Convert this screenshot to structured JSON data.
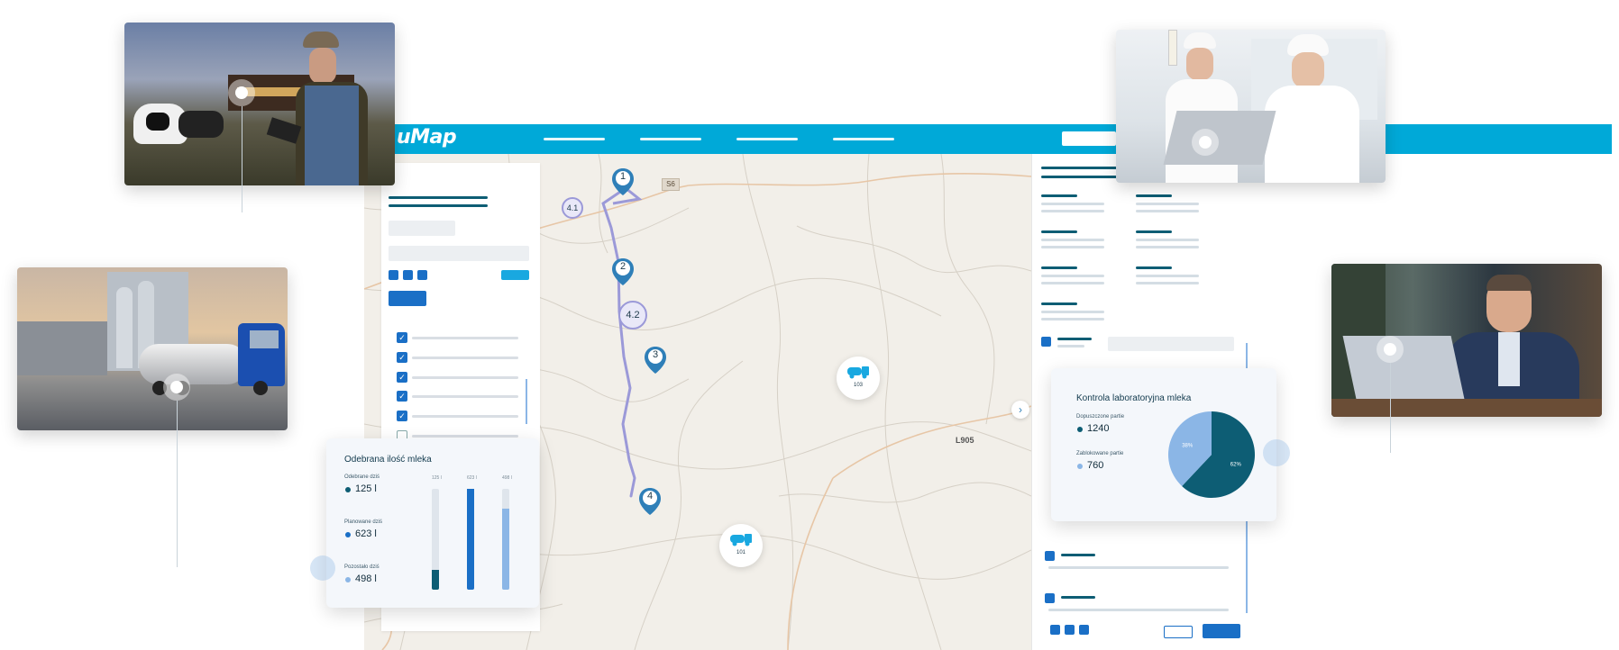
{
  "app": {
    "logo": "uMap"
  },
  "milk_card": {
    "title": "Odebrana ilość mleka",
    "items": [
      {
        "label": "Odebrane dziś",
        "value": "125 l",
        "color": "#0d5d74"
      },
      {
        "label": "Planowane dziś",
        "value": "623 l",
        "color": "#1a6fc6"
      },
      {
        "label": "Pozostało dziś",
        "value": "498 l",
        "color": "#8bb6e6"
      }
    ],
    "bar_labels": [
      "125 l",
      "623 l",
      "498 l"
    ]
  },
  "lab_card": {
    "title": "Kontrola laboratoryjna mleka",
    "items": [
      {
        "label": "Dopuszczone partie",
        "value": "1240",
        "color": "#0d5d74"
      },
      {
        "label": "Zablokowane partie",
        "value": "760",
        "color": "#8bb6e6"
      }
    ],
    "pie_labels": [
      "62%",
      "38%"
    ]
  },
  "chart_data": [
    {
      "type": "bar",
      "title": "Odebrana ilość mleka",
      "categories": [
        "Odebrane dziś",
        "Planowane dziś",
        "Pozostało dziś"
      ],
      "values": [
        125,
        623,
        498
      ],
      "ylim": [
        0,
        623
      ]
    },
    {
      "type": "pie",
      "title": "Kontrola laboratoryjna mleka",
      "categories": [
        "Dopuszczone partie",
        "Zablokowane partie"
      ],
      "values": [
        62,
        38
      ],
      "colors": [
        "#0d5d74",
        "#8bb6e6"
      ]
    }
  ],
  "map": {
    "route_stops": [
      "1",
      "4.1",
      "2",
      "4.2",
      "3",
      "4"
    ],
    "road_labels": [
      "S6",
      "L905"
    ],
    "vehicles": [
      "103",
      "101"
    ],
    "colors": {
      "route": "#9b99d8",
      "marker": "#2f7fb8",
      "truck": "#19a8e0"
    }
  },
  "icons": [
    "checkbox-checked-icon",
    "truck-icon",
    "chevron-right-icon",
    "location-pin-icon"
  ]
}
